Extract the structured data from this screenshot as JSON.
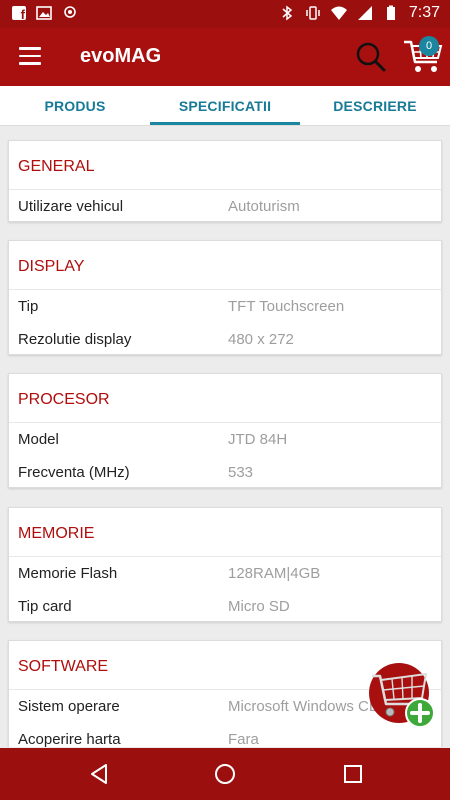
{
  "status_bar": {
    "time": "7:37",
    "icons": [
      "facebook-icon",
      "image-icon",
      "location-icon",
      "bluetooth-icon",
      "vibrate-icon",
      "wifi-icon",
      "signal-icon",
      "battery-icon"
    ]
  },
  "app_bar": {
    "title": "evoMAG",
    "cart_count": "0"
  },
  "tabs": [
    {
      "label": "PRODUS",
      "active": false
    },
    {
      "label": "SPECIFICATII",
      "active": true
    },
    {
      "label": "DESCRIERE",
      "active": false
    }
  ],
  "sections": [
    {
      "title": "GENERAL",
      "rows": [
        {
          "label": "Utilizare vehicul",
          "value": "Autoturism"
        }
      ]
    },
    {
      "title": "DISPLAY",
      "rows": [
        {
          "label": "Tip",
          "value": "TFT Touchscreen"
        },
        {
          "label": "Rezolutie display",
          "value": "480 x 272"
        }
      ]
    },
    {
      "title": "PROCESOR",
      "rows": [
        {
          "label": "Model",
          "value": "JTD 84H"
        },
        {
          "label": "Frecventa (MHz)",
          "value": "533"
        }
      ]
    },
    {
      "title": "MEMORIE",
      "rows": [
        {
          "label": "Memorie Flash",
          "value": "128RAM|4GB"
        },
        {
          "label": "Tip card",
          "value": "Micro SD"
        }
      ]
    },
    {
      "title": "SOFTWARE",
      "rows": [
        {
          "label": "Sistem operare",
          "value": "Microsoft Windows CE"
        },
        {
          "label": "Acoperire harta",
          "value": "Fara"
        }
      ]
    }
  ],
  "colors": {
    "app_bar": "#a81010",
    "status_bar": "#9b0f0f",
    "accent": "#1b86a0",
    "section_title": "#b00d0d"
  }
}
